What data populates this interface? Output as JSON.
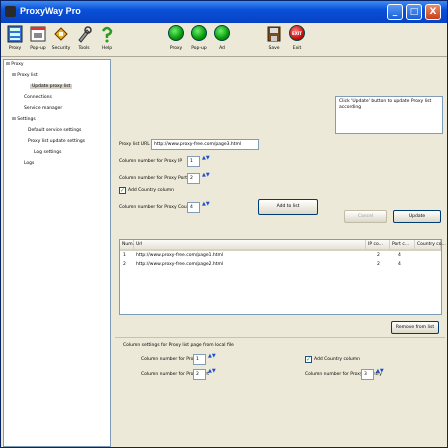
{
  "window": {
    "title": "ProxyWay Pro",
    "controls": [
      "_",
      "□",
      "X"
    ]
  },
  "toolbar": {
    "items": [
      {
        "label": "Proxy",
        "icon": "proxy-icon"
      },
      {
        "label": "Pop-up",
        "icon": "popup-icon"
      },
      {
        "label": "Security",
        "icon": "security-icon"
      },
      {
        "label": "Tools",
        "icon": "tools-icon"
      },
      {
        "label": "Help",
        "icon": "help-icon"
      },
      {
        "label": "Proxy",
        "icon": "proxy-on-icon"
      },
      {
        "label": "Pop-up",
        "icon": "popup-on-icon"
      },
      {
        "label": "Ad",
        "icon": "ad-on-icon"
      },
      {
        "label": "Save",
        "icon": "save-icon"
      },
      {
        "label": "Exit",
        "icon": "exit-icon"
      }
    ],
    "exit_glyph": "EXIT"
  },
  "tree": {
    "nodes": [
      {
        "label": "Proxy",
        "expander": "⊟"
      },
      {
        "label": "Proxy list",
        "expander": "⊟"
      },
      {
        "label": "Update proxy list",
        "expander": ""
      },
      {
        "label": "Connections",
        "expander": ""
      },
      {
        "label": "Service manager",
        "expander": ""
      },
      {
        "label": "Settings",
        "expander": "⊟"
      },
      {
        "label": "Default service settings",
        "expander": ""
      },
      {
        "label": "Proxy list update settings",
        "expander": ""
      },
      {
        "label": "Log settings",
        "expander": ""
      },
      {
        "label": "Logs",
        "expander": ""
      }
    ]
  },
  "form": {
    "proxy_list_url_label": "Proxy list URL",
    "proxy_list_url_value": "http://www.proxy-free.com/page3.html",
    "col_ip_label": "Column number for Proxy IP",
    "col_ip_value": "1",
    "col_port_label": "Column number for Proxy Port",
    "col_port_value": "2",
    "add_country_label": "Add Country column",
    "col_country_label": "Column number for Proxy Country",
    "col_country_value": "4",
    "add_button": "Add to list",
    "cancel_button": "Cancel",
    "update_button": "Update"
  },
  "info": {
    "text": "Click 'Update' button to update Proxy list according"
  },
  "table": {
    "headers": [
      "Num...",
      "Url",
      "IP co...",
      "Port c...",
      "Country co..."
    ],
    "rows": [
      {
        "num": "1",
        "url": "http://www.proxy-free.com/page1.html",
        "ip": "2",
        "port": "4",
        "country": ""
      },
      {
        "num": "2",
        "url": "http://www.proxy-free.com/page2.html",
        "ip": "2",
        "port": "4",
        "country": ""
      }
    ]
  },
  "remove_button": "Remove from list",
  "column_settings": {
    "title": "Column settings for Proxy list page from local file",
    "col_ip_label": "Column number for Proxy IP",
    "col_ip_value": "1",
    "col_port_label": "Column number for Proxy Port",
    "col_port_value": "2",
    "add_country_label": "Add Country column",
    "col_country_label": "Column number for Proxy Country",
    "col_country_value": "3"
  },
  "spin_glyph": "▲▼",
  "check_glyph": "✓",
  "colors": {
    "titlebar": "#0a50d8",
    "face": "#ece9d8",
    "border": "#7f9db9"
  }
}
